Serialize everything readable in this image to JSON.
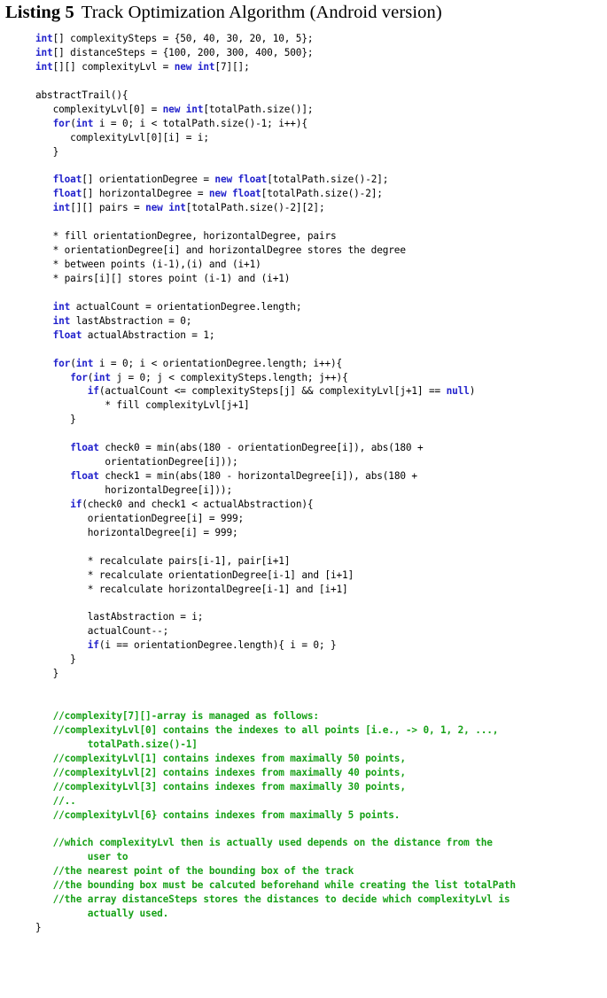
{
  "caption": {
    "label": "Listing 5",
    "title": "Track Optimization Algorithm (Android version)"
  },
  "colors": {
    "keyword": "#2222cc",
    "comment": "#17a117",
    "text": "#000000",
    "background": "#ffffff"
  },
  "code": {
    "language": "java",
    "lines": [
      [
        {
          "t": "kw",
          "s": "int"
        },
        {
          "t": "txt",
          "s": "[] complexitySteps = {50, 40, 30, 20, 10, 5};"
        }
      ],
      [
        {
          "t": "kw",
          "s": "int"
        },
        {
          "t": "txt",
          "s": "[] distanceSteps = {100, 200, 300, 400, 500};"
        }
      ],
      [
        {
          "t": "kw",
          "s": "int"
        },
        {
          "t": "txt",
          "s": "[][] complexityLvl = "
        },
        {
          "t": "kw",
          "s": "new"
        },
        {
          "t": "txt",
          "s": " "
        },
        {
          "t": "kw",
          "s": "int"
        },
        {
          "t": "txt",
          "s": "[7][];"
        }
      ],
      [],
      [
        {
          "t": "txt",
          "s": "abstractTrail(){"
        }
      ],
      [
        {
          "t": "txt",
          "s": "   complexityLvl[0] = "
        },
        {
          "t": "kw",
          "s": "new"
        },
        {
          "t": "txt",
          "s": " "
        },
        {
          "t": "kw",
          "s": "int"
        },
        {
          "t": "txt",
          "s": "[totalPath.size()];"
        }
      ],
      [
        {
          "t": "txt",
          "s": "   "
        },
        {
          "t": "kw",
          "s": "for"
        },
        {
          "t": "txt",
          "s": "("
        },
        {
          "t": "kw",
          "s": "int"
        },
        {
          "t": "txt",
          "s": " i = 0; i < totalPath.size()-1; i++){"
        }
      ],
      [
        {
          "t": "txt",
          "s": "      complexityLvl[0][i] = i;"
        }
      ],
      [
        {
          "t": "txt",
          "s": "   }"
        }
      ],
      [],
      [
        {
          "t": "txt",
          "s": "   "
        },
        {
          "t": "kw",
          "s": "float"
        },
        {
          "t": "txt",
          "s": "[] orientationDegree = "
        },
        {
          "t": "kw",
          "s": "new"
        },
        {
          "t": "txt",
          "s": " "
        },
        {
          "t": "kw",
          "s": "float"
        },
        {
          "t": "txt",
          "s": "[totalPath.size()-2];"
        }
      ],
      [
        {
          "t": "txt",
          "s": "   "
        },
        {
          "t": "kw",
          "s": "float"
        },
        {
          "t": "txt",
          "s": "[] horizontalDegree = "
        },
        {
          "t": "kw",
          "s": "new"
        },
        {
          "t": "txt",
          "s": " "
        },
        {
          "t": "kw",
          "s": "float"
        },
        {
          "t": "txt",
          "s": "[totalPath.size()-2];"
        }
      ],
      [
        {
          "t": "txt",
          "s": "   "
        },
        {
          "t": "kw",
          "s": "int"
        },
        {
          "t": "txt",
          "s": "[][] pairs = "
        },
        {
          "t": "kw",
          "s": "new"
        },
        {
          "t": "txt",
          "s": " "
        },
        {
          "t": "kw",
          "s": "int"
        },
        {
          "t": "txt",
          "s": "[totalPath.size()-2][2];"
        }
      ],
      [],
      [
        {
          "t": "txt",
          "s": "   * fill orientationDegree, horizontalDegree, pairs"
        }
      ],
      [
        {
          "t": "txt",
          "s": "   * orientationDegree[i] and horizontalDegree stores the degree"
        }
      ],
      [
        {
          "t": "txt",
          "s": "   * between points (i-1),(i) and (i+1)"
        }
      ],
      [
        {
          "t": "txt",
          "s": "   * pairs[i][] stores point (i-1) and (i+1)"
        }
      ],
      [],
      [
        {
          "t": "txt",
          "s": "   "
        },
        {
          "t": "kw",
          "s": "int"
        },
        {
          "t": "txt",
          "s": " actualCount = orientationDegree.length;"
        }
      ],
      [
        {
          "t": "txt",
          "s": "   "
        },
        {
          "t": "kw",
          "s": "int"
        },
        {
          "t": "txt",
          "s": " lastAbstraction = 0;"
        }
      ],
      [
        {
          "t": "txt",
          "s": "   "
        },
        {
          "t": "kw",
          "s": "float"
        },
        {
          "t": "txt",
          "s": " actualAbstraction = 1;"
        }
      ],
      [],
      [
        {
          "t": "txt",
          "s": "   "
        },
        {
          "t": "kw",
          "s": "for"
        },
        {
          "t": "txt",
          "s": "("
        },
        {
          "t": "kw",
          "s": "int"
        },
        {
          "t": "txt",
          "s": " i = 0; i < orientationDegree.length; i++){"
        }
      ],
      [
        {
          "t": "txt",
          "s": "      "
        },
        {
          "t": "kw",
          "s": "for"
        },
        {
          "t": "txt",
          "s": "("
        },
        {
          "t": "kw",
          "s": "int"
        },
        {
          "t": "txt",
          "s": " j = 0; j < complexitySteps.length; j++){"
        }
      ],
      [
        {
          "t": "txt",
          "s": "         "
        },
        {
          "t": "kw",
          "s": "if"
        },
        {
          "t": "txt",
          "s": "(actualCount <= complexitySteps[j] && complexityLvl[j+1] == "
        },
        {
          "t": "kw",
          "s": "null"
        },
        {
          "t": "txt",
          "s": ")"
        }
      ],
      [
        {
          "t": "txt",
          "s": "            * fill complexityLvl[j+1]"
        }
      ],
      [
        {
          "t": "txt",
          "s": "      }"
        }
      ],
      [],
      [
        {
          "t": "txt",
          "s": "      "
        },
        {
          "t": "kw",
          "s": "float"
        },
        {
          "t": "txt",
          "s": " check0 = min(abs(180 - orientationDegree[i]), abs(180 +"
        }
      ],
      [
        {
          "t": "txt",
          "s": "            orientationDegree[i]));"
        }
      ],
      [
        {
          "t": "txt",
          "s": "      "
        },
        {
          "t": "kw",
          "s": "float"
        },
        {
          "t": "txt",
          "s": " check1 = min(abs(180 - horizontalDegree[i]), abs(180 +"
        }
      ],
      [
        {
          "t": "txt",
          "s": "            horizontalDegree[i]));"
        }
      ],
      [
        {
          "t": "txt",
          "s": "      "
        },
        {
          "t": "kw",
          "s": "if"
        },
        {
          "t": "txt",
          "s": "(check0 and check1 < actualAbstraction){"
        }
      ],
      [
        {
          "t": "txt",
          "s": "         orientationDegree[i] = 999;"
        }
      ],
      [
        {
          "t": "txt",
          "s": "         horizontalDegree[i] = 999;"
        }
      ],
      [],
      [
        {
          "t": "txt",
          "s": "         * recalculate pairs[i-1], pair[i+1]"
        }
      ],
      [
        {
          "t": "txt",
          "s": "         * recalculate orientationDegree[i-1] and [i+1]"
        }
      ],
      [
        {
          "t": "txt",
          "s": "         * recalculate horizontalDegree[i-1] and [i+1]"
        }
      ],
      [],
      [
        {
          "t": "txt",
          "s": "         lastAbstraction = i;"
        }
      ],
      [
        {
          "t": "txt",
          "s": "         actualCount--;"
        }
      ],
      [
        {
          "t": "txt",
          "s": "         "
        },
        {
          "t": "kw",
          "s": "if"
        },
        {
          "t": "txt",
          "s": "(i == orientationDegree.length){ i = 0; }"
        }
      ],
      [
        {
          "t": "txt",
          "s": "      }"
        }
      ],
      [
        {
          "t": "txt",
          "s": "   }"
        }
      ],
      [],
      [],
      [
        {
          "t": "cm",
          "s": "   //complexity[7][]-array is managed as follows:"
        }
      ],
      [
        {
          "t": "cm",
          "s": "   //complexityLvl[0] contains the indexes to all points [i.e., -> 0, 1, 2, ...,"
        }
      ],
      [
        {
          "t": "cm",
          "s": "         totalPath.size()-1]"
        }
      ],
      [
        {
          "t": "cm",
          "s": "   //complexityLvl[1] contains indexes from maximally 50 points,"
        }
      ],
      [
        {
          "t": "cm",
          "s": "   //complexityLvl[2] contains indexes from maximally 40 points,"
        }
      ],
      [
        {
          "t": "cm",
          "s": "   //complexityLvl[3] contains indexes from maximally 30 points,"
        }
      ],
      [
        {
          "t": "cm",
          "s": "   //.."
        }
      ],
      [
        {
          "t": "cm",
          "s": "   //complexityLvl[6} contains indexes from maximally 5 points."
        }
      ],
      [],
      [
        {
          "t": "cm",
          "s": "   //which complexityLvl then is actually used depends on the distance from the"
        }
      ],
      [
        {
          "t": "cm",
          "s": "         user to"
        }
      ],
      [
        {
          "t": "cm",
          "s": "   //the nearest point of the bounding box of the track"
        }
      ],
      [
        {
          "t": "cm",
          "s": "   //the bounding box must be calcuted beforehand while creating the list totalPath"
        }
      ],
      [
        {
          "t": "cm",
          "s": "   //the array distanceSteps stores the distances to decide which complexityLvl is"
        }
      ],
      [
        {
          "t": "cm",
          "s": "         actually used."
        }
      ],
      [
        {
          "t": "txt",
          "s": "}"
        }
      ]
    ]
  }
}
